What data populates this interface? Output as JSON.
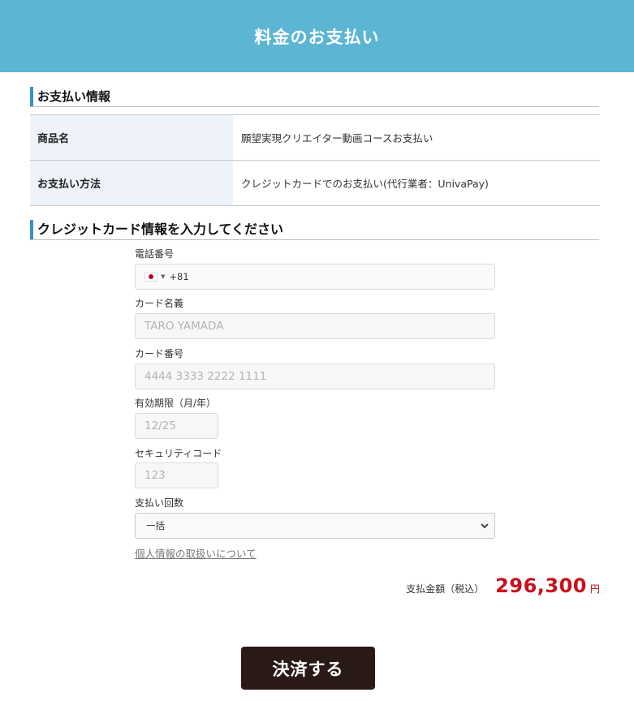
{
  "header": {
    "title": "料金のお支払い"
  },
  "payment_info": {
    "heading": "お支払い情報",
    "rows": [
      {
        "label": "商品名",
        "value": "願望実現クリエイター動画コースお支払い"
      },
      {
        "label": "お支払い方法",
        "value": "クレジットカードでのお支払い(代行業者：UnivaPay)"
      }
    ]
  },
  "card_section": {
    "heading": "クレジットカード情報を入力してください",
    "phone": {
      "label": "電話番号",
      "dial_code": "+81",
      "flag": "japan-flag-icon"
    },
    "card_name": {
      "label": "カード名義",
      "placeholder": "TARO YAMADA"
    },
    "card_number": {
      "label": "カード番号",
      "placeholder": "4444 3333 2222 1111"
    },
    "expiry": {
      "label": "有効期限（月/年）",
      "placeholder": "12/25"
    },
    "cvc": {
      "label": "セキュリティコード",
      "placeholder": "123"
    },
    "installments": {
      "label": "支払い回数",
      "selected": "一括"
    },
    "privacy_link": "個人情報の取扱いについて"
  },
  "total": {
    "label": "支払金額（税込）",
    "amount": "296,300",
    "unit": "円"
  },
  "submit": {
    "label": "決済する"
  },
  "colors": {
    "header_bg": "#5bb5d3",
    "accent_bar": "#3b8fcb",
    "price": "#c9101b",
    "button_bg": "#2a1a17"
  }
}
